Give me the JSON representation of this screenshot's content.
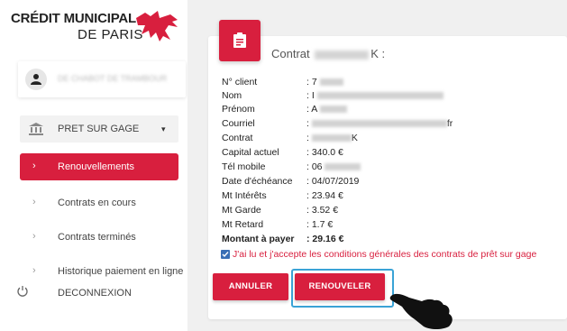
{
  "brand": {
    "line1": "CRÉDIT MUNICIPAL",
    "line2": "DE PARIS"
  },
  "user": {
    "name": "DE CHABOT DE TRAMBOUR"
  },
  "sidebar": {
    "group_label": "PRET SUR GAGE",
    "items": [
      {
        "label": "Renouvellements",
        "active": true
      },
      {
        "label": "Contrats en cours",
        "active": false
      },
      {
        "label": "Contrats terminés",
        "active": false
      },
      {
        "label": "Historique paiement en ligne",
        "active": false
      }
    ],
    "logout_label": "DECONNEXION"
  },
  "card": {
    "title_prefix": "Contrat",
    "title_suffix": "K :",
    "rows": [
      {
        "key": "N° client",
        "value": ": 7"
      },
      {
        "key": "Nom",
        "value": ": I"
      },
      {
        "key": "Prénom",
        "value": ": A"
      },
      {
        "key": "Courriel",
        "value": ":",
        "suffix": "fr"
      },
      {
        "key": "Contrat",
        "value": ":",
        "suffix": "K"
      },
      {
        "key": "Capital actuel",
        "value": ": 340.0 €"
      },
      {
        "key": "Tél mobile",
        "value": ": 06"
      },
      {
        "key": "Date d'échéance",
        "value": ": 04/07/2019"
      },
      {
        "key": "Mt Intérêts",
        "value": ": 23.94 €"
      },
      {
        "key": "Mt Garde",
        "value": ": 3.52 €"
      },
      {
        "key": "Mt Retard",
        "value": ": 1.7 €"
      },
      {
        "key": "Montant à payer",
        "value": ": 29.16 €",
        "bold": true
      }
    ],
    "terms": "J'ai lu et j'accepte les conditions générales des contrats de prêt sur gage",
    "terms_checked": true
  },
  "buttons": {
    "cancel": "ANNULER",
    "renew": "RENOUVELER"
  },
  "colors": {
    "accent": "#d81f3e",
    "highlight": "#3aa3d6"
  }
}
